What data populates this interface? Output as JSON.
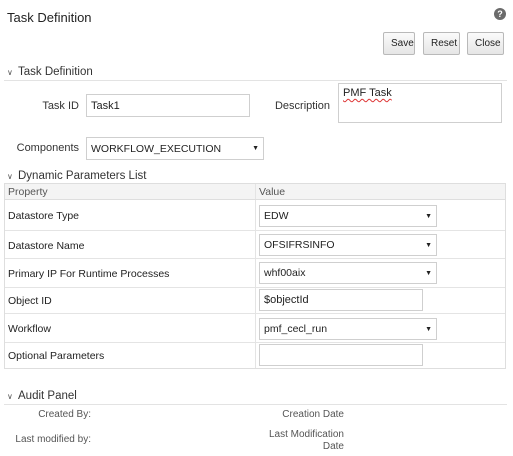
{
  "page": {
    "title": "Task Definition"
  },
  "toolbar": {
    "save_label": "Save",
    "reset_label": "Reset",
    "close_label": "Close"
  },
  "task_section": {
    "title": "Task Definition",
    "task_id_label": "Task ID",
    "task_id_value": "Task1",
    "description_label": "Description",
    "description_value": "PMF Task",
    "components_label": "Components",
    "components_value": "WORKFLOW_EXECUTION"
  },
  "params_section": {
    "title": "Dynamic Parameters List",
    "columns": {
      "property": "Property",
      "value": "Value"
    },
    "rows": [
      {
        "property": "Datastore Type",
        "value": "EDW",
        "kind": "select"
      },
      {
        "property": "Datastore Name",
        "value": "OFSIFRSINFO",
        "kind": "select"
      },
      {
        "property": "Primary IP For Runtime Processes",
        "value": "whf00aix",
        "kind": "select"
      },
      {
        "property": "Object ID",
        "value": "$objectId",
        "kind": "text"
      },
      {
        "property": "Workflow",
        "value": "pmf_cecl_run",
        "kind": "select"
      },
      {
        "property": "Optional Parameters",
        "value": "",
        "kind": "text"
      }
    ]
  },
  "audit_section": {
    "title": "Audit Panel",
    "created_by_label": "Created By:",
    "creation_date_label": "Creation Date",
    "last_modified_by_label": "Last modified by:",
    "last_modification_date_label_1": "Last Modification",
    "last_modification_date_label_2": "Date"
  },
  "icons": {
    "help": "help-icon",
    "section_toggle": "chevron-down-icon",
    "dropdown": "dropdown-arrow-icon"
  }
}
